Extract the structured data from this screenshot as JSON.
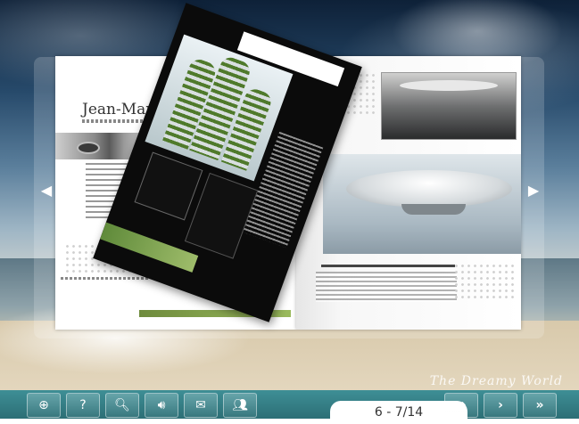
{
  "spread": {
    "author_name": "Jean-Marie M",
    "signature": "The Dreamy World",
    "icons": {
      "prev": "chevron-left-icon",
      "next": "chevron-right-icon"
    }
  },
  "toolbar": {
    "page_counter": "6 - 7/14",
    "icons": {
      "zoom": "zoom-in-icon",
      "help": "question-icon",
      "search": "search-icon",
      "sound": "speaker-icon",
      "mail": "envelope-icon",
      "share": "people-icon",
      "prev": "chevron-right-icon",
      "next": "chevron-right-icon",
      "last": "double-chevron-right-icon"
    },
    "colors": {
      "bar": "#2f7b82"
    }
  }
}
